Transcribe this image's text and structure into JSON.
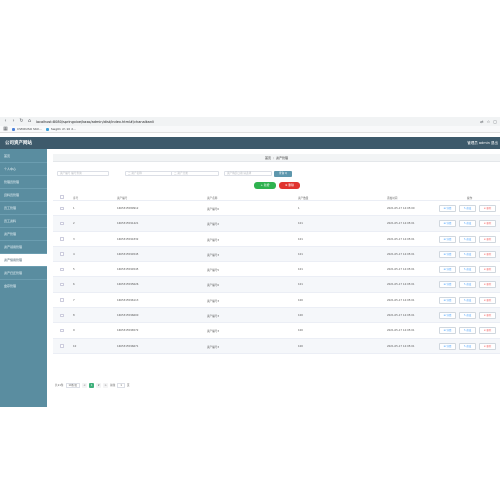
{
  "browser": {
    "url": "localhost:8080/springxixe/kaxo/admin/dist/index.html#/chanalkanli",
    "bookmarks": [
      {
        "label": "CSMXUSO SKX...",
        "color": "#4a7fd8"
      },
      {
        "label": "Swg01 ch 10 d...",
        "color": "#3aa0d8"
      }
    ]
  },
  "app": {
    "title": "公司资产网站",
    "user": "管理员 admin  退出"
  },
  "sidebar": {
    "items": [
      {
        "label": "首页",
        "active": false
      },
      {
        "label": "个人中心",
        "active": false
      },
      {
        "label": "管理员管理",
        "active": false
      },
      {
        "label": "資料员管理",
        "active": false
      },
      {
        "label": "员工管理",
        "active": false
      },
      {
        "label": "员工资料",
        "active": false
      },
      {
        "label": "资产管理",
        "active": false
      },
      {
        "label": "资产领用管理",
        "active": false
      },
      {
        "label": "资产借用管理",
        "active": true
      },
      {
        "label": "资产归还管理",
        "active": false
      },
      {
        "label": "盘存管理",
        "active": false
      }
    ]
  },
  "breadcrumb": {
    "home": "首页",
    "separator": "/",
    "current": "资产管理"
  },
  "filters": {
    "f1": "资产编号 编号查询",
    "f2": "二 资产名称",
    "f3": "二 资产分类",
    "f4": "资产购买日期 请选择",
    "query": "查询 Q"
  },
  "actions": {
    "add": "+ 新增",
    "delete": "⊗ 删除"
  },
  "table": {
    "headers": [
      "序号",
      "资产编号",
      "资产名称",
      "资产数量",
      "添加时间",
      "操作"
    ],
    "rows": [
      {
        "no": "1",
        "code": "1665315589912",
        "name": "资产编号0",
        "qty": "1",
        "time": "2021-05-17 14:05:00"
      },
      {
        "no": "2",
        "code": "1665315591421",
        "name": "资产编号2",
        "qty": "101",
        "time": "2021-05-17 14:05:01"
      },
      {
        "no": "3",
        "code": "1665315594332",
        "name": "资产编号3",
        "qty": "101",
        "time": "2021-05-17 14:05:01"
      },
      {
        "no": "4",
        "code": "1665315594545",
        "name": "资产编号3",
        "qty": "101",
        "time": "2021-05-17 14:05:01"
      },
      {
        "no": "5",
        "code": "1665315594545",
        "name": "资产编号5",
        "qty": "101",
        "time": "2021-05-17 14:05:01"
      },
      {
        "no": "6",
        "code": "1665315595626",
        "name": "资产编号6",
        "qty": "101",
        "time": "2021-05-17 14:05:01"
      },
      {
        "no": "7",
        "code": "1665315596113",
        "name": "资产编号3",
        "qty": "100",
        "time": "2021-05-17 14:05:01"
      },
      {
        "no": "8",
        "code": "1665315596600",
        "name": "资产编号3",
        "qty": "100",
        "time": "2021-05-17 14:05:01"
      },
      {
        "no": "9",
        "code": "1665315596572",
        "name": "资产编号3",
        "qty": "100",
        "time": "2021-05-17 14:05:01"
      },
      {
        "no": "10",
        "code": "1665315596671",
        "name": "资产编号3",
        "qty": "100",
        "time": "2021-05-17 14:05:01"
      }
    ],
    "buttons": {
      "detail": "☰ 详情",
      "edit": "✎ 修改",
      "remove": "⊗ 删除"
    }
  },
  "pagination": {
    "total": "共11条",
    "page_size": "10条/页",
    "prev": "<",
    "pages": [
      "1",
      "2"
    ],
    "current": "1",
    "next": ">",
    "goto_label": "前往",
    "goto_value": "1",
    "goto_suffix": "页"
  }
}
